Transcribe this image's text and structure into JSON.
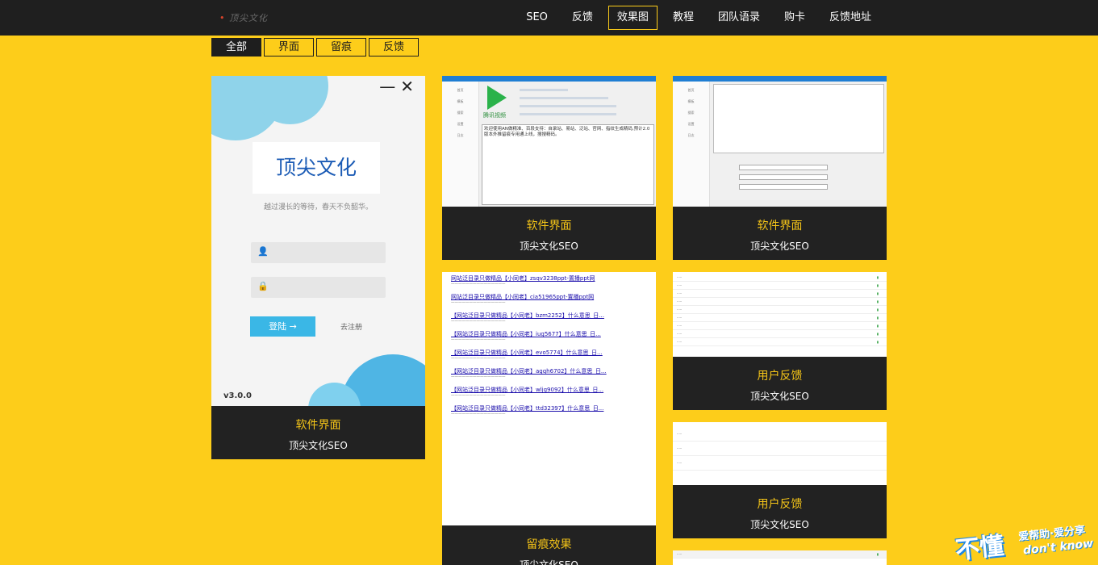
{
  "header": {
    "logo": "顶尖文化",
    "nav": [
      {
        "label": "SEO"
      },
      {
        "label": "反馈"
      },
      {
        "label": "效果图",
        "active": true
      },
      {
        "label": "教程"
      },
      {
        "label": "团队语录"
      },
      {
        "label": "购卡"
      },
      {
        "label": "反馈地址"
      }
    ]
  },
  "filters": [
    {
      "label": "全部",
      "active": true
    },
    {
      "label": "界面"
    },
    {
      "label": "留痕"
    },
    {
      "label": "反馈"
    }
  ],
  "cards": {
    "c1": {
      "title": "软件界面",
      "subtitle": "顶尖文化SEO"
    },
    "c2": {
      "title": "软件界面",
      "subtitle": "顶尖文化SEO"
    },
    "c3": {
      "title": "软件界面",
      "subtitle": "顶尖文化SEO"
    },
    "c4": {
      "title": "留痕效果",
      "subtitle": "顶尖文化SEO"
    },
    "c5": {
      "title": "用户反馈",
      "subtitle": "顶尖文化SEO"
    },
    "c6": {
      "title": "用户反馈",
      "subtitle": "顶尖文化SEO"
    }
  },
  "login_mock": {
    "brand": "顶尖文化",
    "tagline": "越过漫长的等待，春天不负韶华。",
    "login_label": "登陆  →",
    "register_label": "去注册",
    "version": "v3.0.0"
  },
  "software_mock": {
    "video_label": "腾讯视频",
    "log_text": "欢迎使用AN做精准、百段支持：自录站、易站、泛站、官网、指纹生成精码,预计2.0版本外推留痕专用通上线，搜搜精码。"
  },
  "serp_mock": {
    "results": [
      {
        "title": "网站泛目录只做精品【小同老】zsqv3238ppt-置播ppt网"
      },
      {
        "title": "网站泛目录只做精品【小同老】cia51965ppt-置播ppt网"
      },
      {
        "title": "【网站泛目录只做精品【小同老】bzm2252】什么意思_日..."
      },
      {
        "title": "【网站泛目录只做精品【小同老】iug5677】什么意思_日..."
      },
      {
        "title": "【网站泛目录只做精品【小同老】evo5774】什么意思_日..."
      },
      {
        "title": "【网站泛目录只做精品【小同老】agqh6702】什么意思_日..."
      },
      {
        "title": "【网站泛目录只做精品【小同老】wljg9092】什么意思_日..."
      },
      {
        "title": "【网站泛目录只做精品【小同老】ttd32397】什么意思_日..."
      }
    ]
  },
  "badge": {
    "big": "不懂",
    "small": "爱帮助·爱分享",
    "en": "don't know"
  },
  "colors": {
    "background": "#fdcd1a",
    "header": "#1f1f1f",
    "accent": "#f5c518"
  }
}
